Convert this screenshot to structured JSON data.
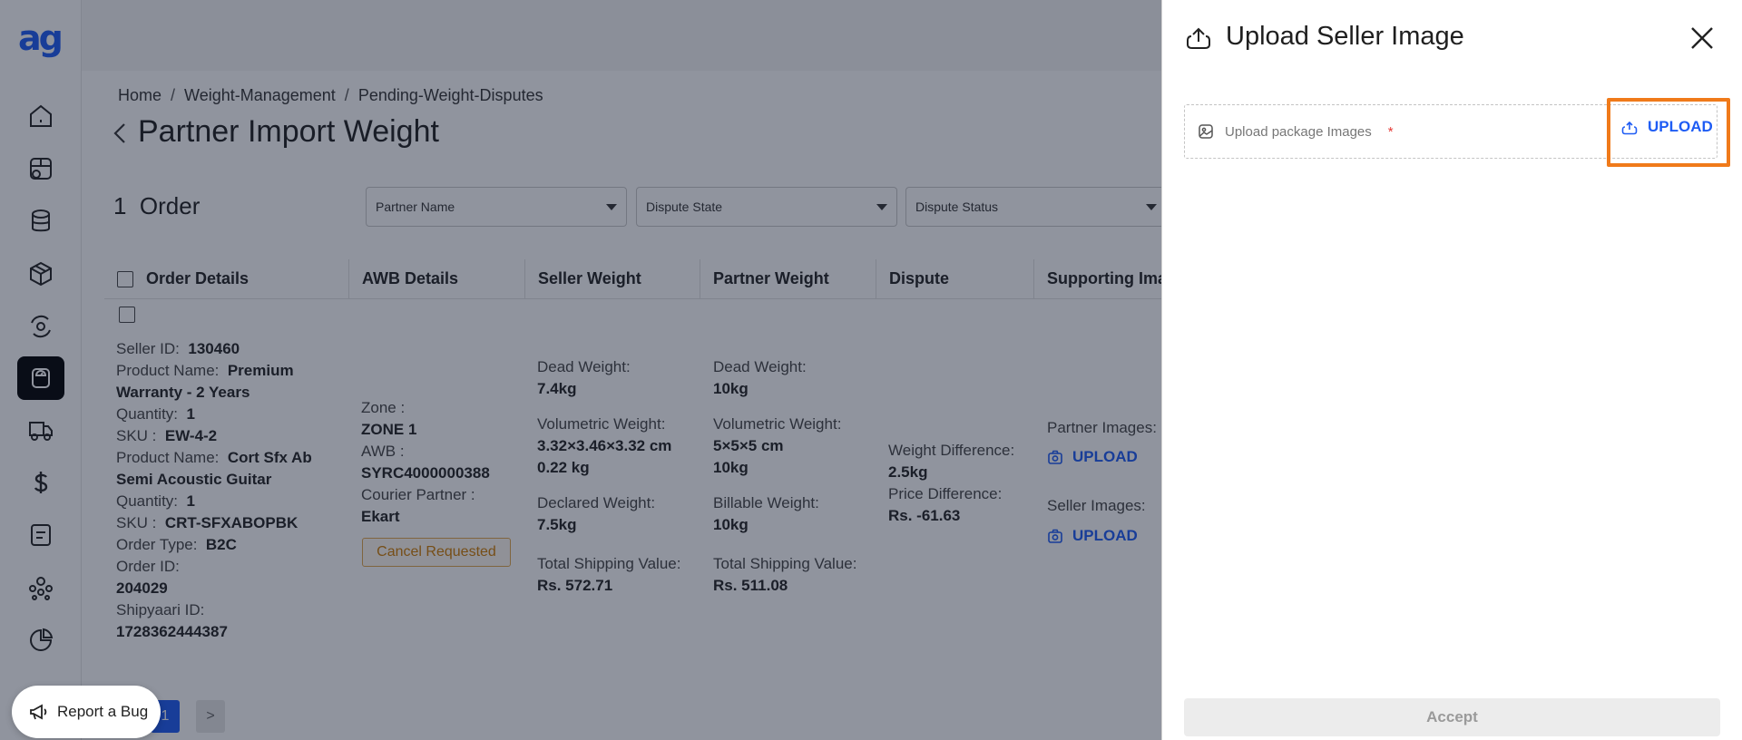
{
  "app": {
    "logo_text": "ag"
  },
  "sidebar": {
    "items": [
      {
        "icon": "home-icon"
      },
      {
        "icon": "store-icon"
      },
      {
        "icon": "database-icon"
      },
      {
        "icon": "package-icon"
      },
      {
        "icon": "settings-cycle-icon"
      },
      {
        "icon": "weighing-scale-icon",
        "active": true
      },
      {
        "icon": "delivery-truck-icon"
      },
      {
        "icon": "dollar-icon"
      },
      {
        "icon": "note-icon"
      },
      {
        "icon": "users-icon"
      },
      {
        "icon": "pie-chart-icon"
      }
    ]
  },
  "breadcrumb": {
    "items": [
      "Home",
      "Weight-Management",
      "Pending-Weight-Disputes"
    ],
    "separator": "/"
  },
  "page": {
    "title": "Partner Import Weight",
    "order_count": "1",
    "order_label": "Order"
  },
  "filters": [
    {
      "placeholder": "Partner Name"
    },
    {
      "placeholder": "Dispute State"
    },
    {
      "placeholder": "Dispute Status"
    }
  ],
  "table": {
    "columns": [
      "Order Details",
      "AWB Details",
      "Seller Weight",
      "Partner Weight",
      "Dispute",
      "Supporting Ima"
    ],
    "row": {
      "order_details": {
        "seller_id_label": "Seller ID:",
        "seller_id": "130460",
        "product1_label": "Product Name:",
        "product1_a": "Premium",
        "product1_b": "Warranty - 2 Years",
        "qty1_label": "Quantity:",
        "qty1": "1",
        "sku1_label": "SKU :",
        "sku1": "EW-4-2",
        "product2_label": "Product Name:",
        "product2_a": "Cort Sfx Ab",
        "product2_b": "Semi Acoustic Guitar",
        "qty2_label": "Quantity:",
        "qty2": "1",
        "sku2_label": "SKU :",
        "sku2": "CRT-SFXABOPBK",
        "order_type_label": "Order Type:",
        "order_type": "B2C",
        "order_id_label": "Order ID:",
        "order_id": "204029",
        "shipyaari_id_label": "Shipyaari ID:",
        "shipyaari_id": "1728362444387"
      },
      "awb": {
        "zone_label": "Zone :",
        "zone": "ZONE 1",
        "awb_label": "AWB :",
        "awb": "SYRC4000000388",
        "courier_label": "Courier Partner :",
        "courier": "Ekart",
        "status_badge": "Cancel Requested"
      },
      "seller_weight": {
        "dead_label": "Dead Weight:",
        "dead": "7.4kg",
        "vol_label": "Volumetric Weight:",
        "vol_dims": "3.32×3.46×3.32 cm",
        "vol": "0.22 kg",
        "declared_label": "Declared Weight:",
        "declared": "7.5kg",
        "shipping_label": "Total Shipping Value:",
        "shipping": "Rs. 572.71"
      },
      "partner_weight": {
        "dead_label": "Dead Weight:",
        "dead": "10kg",
        "vol_label": "Volumetric Weight:",
        "vol_dims": "5×5×5 cm",
        "vol": "10kg",
        "billable_label": "Billable Weight:",
        "billable": "10kg",
        "shipping_label": "Total Shipping Value:",
        "shipping": "Rs. 511.08"
      },
      "dispute": {
        "weight_diff_label": "Weight Difference:",
        "weight_diff": "2.5kg",
        "price_diff_label": "Price Difference:",
        "price_diff": "Rs. -61.63"
      },
      "supporting": {
        "partner_label": "Partner Images:",
        "partner_action": "UPLOAD",
        "seller_label": "Seller Images:",
        "seller_action": "UPLOAD"
      }
    }
  },
  "pagination": {
    "current": "1",
    "next": ">"
  },
  "report_bug": {
    "label": "Report a Bug"
  },
  "drawer": {
    "title": "Upload Seller Image",
    "upload_field_label": "Upload package Images",
    "required_mark": "*",
    "upload_button": "UPLOAD",
    "accept_button": "Accept"
  },
  "colors": {
    "accent": "#1e5cf4",
    "highlight": "#f07a1a",
    "badge": "#cf7b00"
  }
}
